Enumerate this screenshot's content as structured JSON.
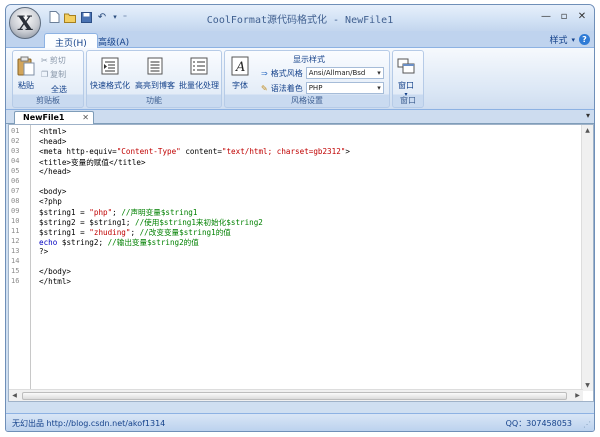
{
  "window": {
    "title": "CoolFormat源代码格式化 - NewFile1"
  },
  "ribbon_tabs": [
    {
      "label": "主页(H)",
      "active": true
    },
    {
      "label": "高级(A)",
      "active": false
    }
  ],
  "style_menu": "样式",
  "groups": {
    "clipboard": {
      "label": "剪贴板",
      "paste": "粘贴",
      "cut": "剪切",
      "copy": "复制",
      "select_all": "全选"
    },
    "function": {
      "label": "功能",
      "quick_format": "快速格式化",
      "highlight_blog": "高亮到博客",
      "batch_process": "批量化处理"
    },
    "style_settings": {
      "label": "风格设置",
      "font": "字体",
      "display_style": "显示样式",
      "format_style_label": "格式风格",
      "format_style_value": "Ansi/Allman/Bsd",
      "syntax_color_label": "语法着色",
      "syntax_color_value": "PHP"
    },
    "window": {
      "label": "窗口",
      "window_btn": "窗口"
    }
  },
  "document_tab": "NewFile1",
  "editor": {
    "line_numbers": [
      "01",
      "02",
      "03",
      "04",
      "05",
      "06",
      "07",
      "08",
      "09",
      "10",
      "11",
      "12",
      "13",
      "14",
      "15",
      "16"
    ],
    "lines": {
      "l1": "<html>",
      "l2": "<head>",
      "l3a": "<meta http-equiv=",
      "l3b": "\"Content-Type\"",
      "l3c": " content=",
      "l3d": "\"text/html; charset=gb2312\"",
      "l3e": ">",
      "l4": "<title>变量的赋值</title>",
      "l5": "</head>",
      "l6": "",
      "l7": "<body>",
      "l8": "<?php",
      "l9a": "$string1 = ",
      "l9b": "\"php\"",
      "l9c": "; ",
      "l9d": "//声明变量$string1",
      "l10a": "$string2 = $string1; ",
      "l10b": "//使用$string1来初始化$string2",
      "l11a": "$string1 = ",
      "l11b": "\"zhuding\"",
      "l11c": "; ",
      "l11d": "//改变变量$string1的值",
      "l12a": "echo",
      "l12b": " $string2; ",
      "l12c": "//输出变量$string2的值",
      "l13": "?>",
      "l14": "",
      "l15": "</body>",
      "l16": "</html>"
    }
  },
  "status": {
    "left": "无幻出品 http://blog.csdn.net/akof1314",
    "right": "QQ：307458053"
  }
}
